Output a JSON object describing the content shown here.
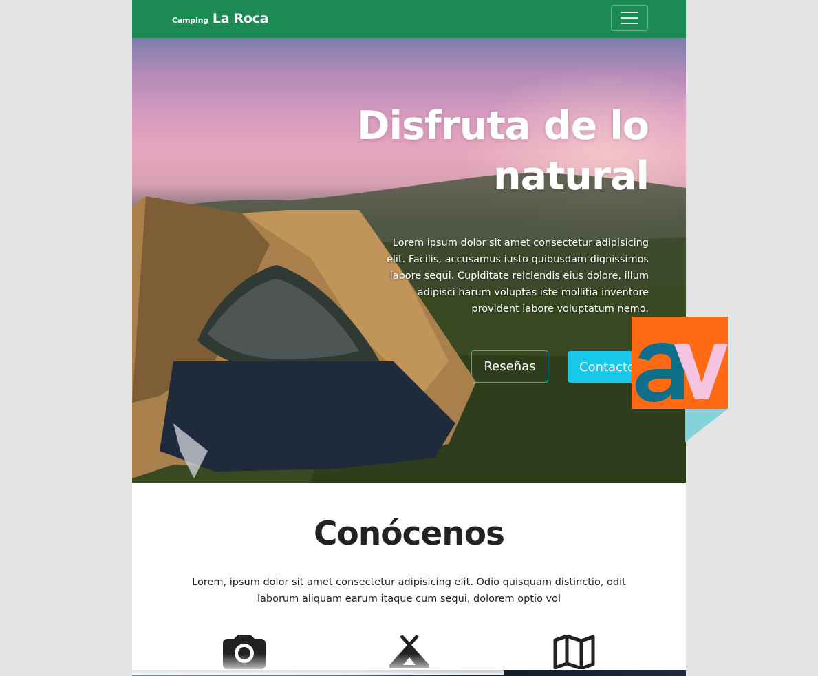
{
  "navbar": {
    "brand_small": "Camping",
    "brand_big": "La Roca",
    "toggle_label": "Toggle navigation"
  },
  "hero": {
    "title_line1": "Disfruta de lo",
    "title_line2": "natural",
    "text": "Lorem ipsum dolor sit amet consectetur adipisicing elit. Facilis, accusamus iusto quibusdam dignissimos labore sequi. Cupiditate reiciendis eius dolore, illum adipisci harum voluptas iste mollitia inventore provident labore voluptatum nemo.",
    "button_reviews": "Reseñas",
    "button_contact": "Contacto"
  },
  "about": {
    "title": "Conócenos",
    "text": "Lorem, ipsum dolor sit amet consectetur adipisicing elit. Odio quisquam distinctio, odit laborum aliquam earum itaque cum sequi, dolorem optio vol",
    "features": [
      {
        "icon": "camera-icon"
      },
      {
        "icon": "tent-icon"
      },
      {
        "icon": "map-icon"
      }
    ]
  },
  "badge": {
    "letters": "av",
    "colors": {
      "orange": "#ff6a13",
      "teal": "#0f6f8a",
      "pink": "#f3c3df",
      "light_teal": "#85d3d8"
    }
  },
  "colors": {
    "navbar": "#1c8a55",
    "button_outline": "#17c3c8",
    "button_solid": "#17c8eb"
  }
}
